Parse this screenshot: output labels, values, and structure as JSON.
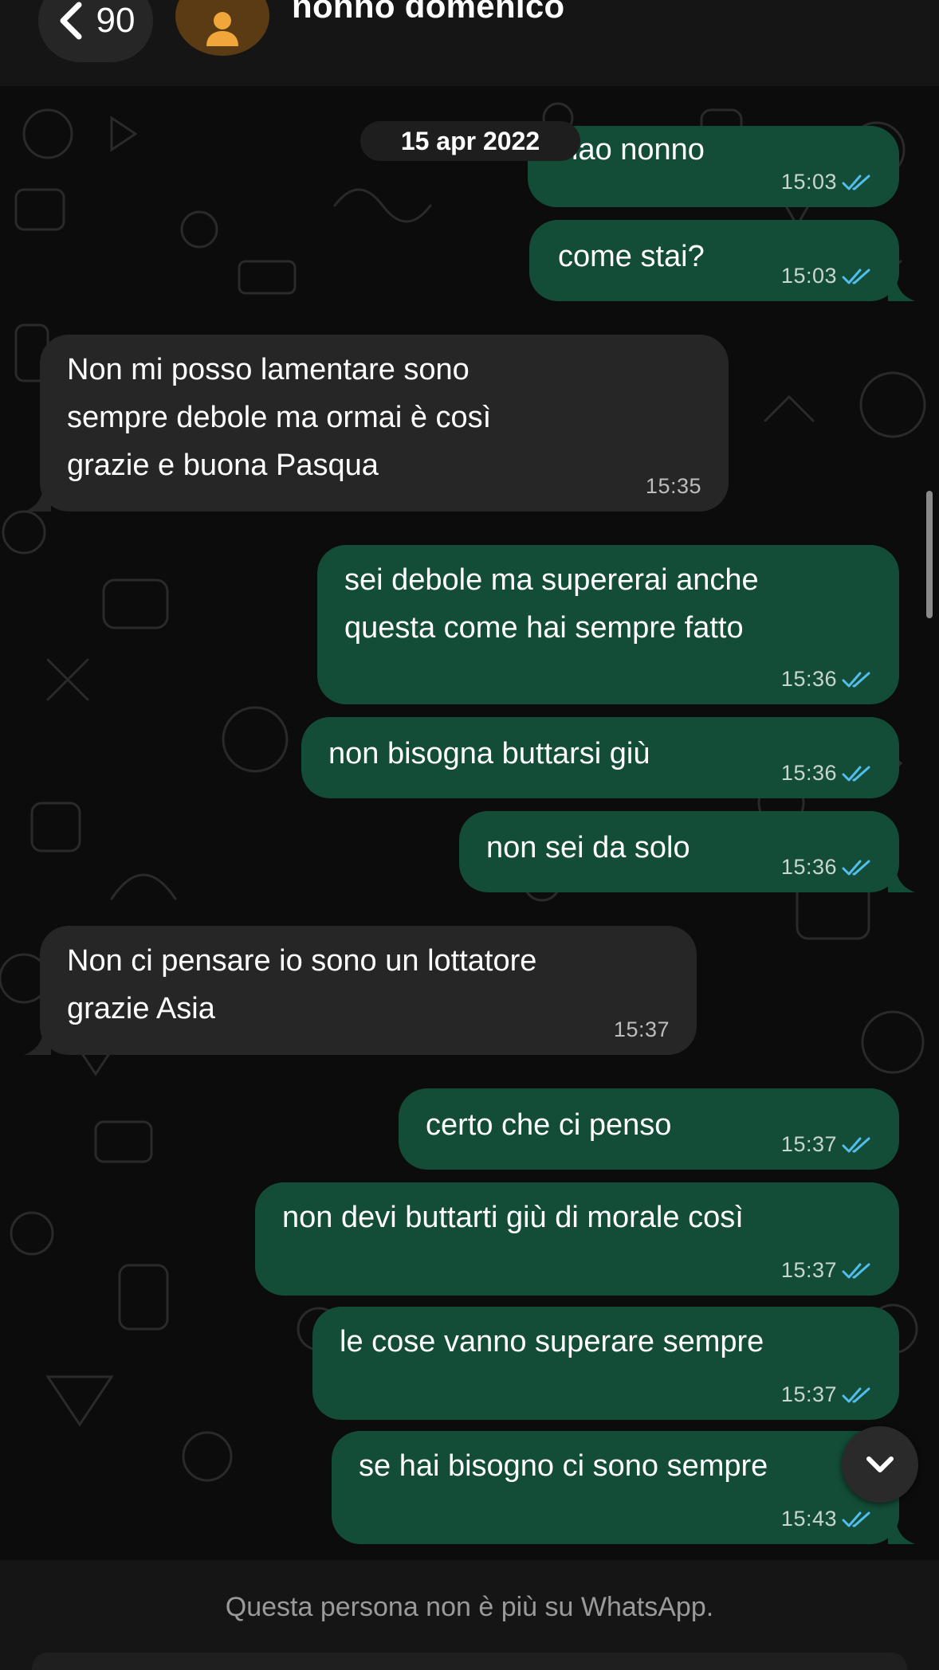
{
  "header": {
    "back_count": "90",
    "contact_name": "nonno domenico"
  },
  "chat": {
    "date_separator": "15 apr 2022",
    "messages": [
      {
        "direction": "outgoing",
        "text": "ciao nonno",
        "time": "15:03",
        "status": "read"
      },
      {
        "direction": "outgoing",
        "text": "come stai?",
        "time": "15:03",
        "status": "read"
      },
      {
        "direction": "incoming",
        "text": "Non mi posso lamentare sono\nsempre debole ma ormai è così\ngrazie e buona Pasqua",
        "time": "15:35"
      },
      {
        "direction": "outgoing",
        "text": "sei debole ma supererai anche\nquesta come hai sempre fatto",
        "time": "15:36",
        "status": "read"
      },
      {
        "direction": "outgoing",
        "text": "non bisogna buttarsi giù",
        "time": "15:36",
        "status": "read"
      },
      {
        "direction": "outgoing",
        "text": "non sei da solo",
        "time": "15:36",
        "status": "read"
      },
      {
        "direction": "incoming",
        "text": "Non ci pensare io sono un lottatore\ngrazie Asia",
        "time": "15:37"
      },
      {
        "direction": "outgoing",
        "text": "certo che ci penso",
        "time": "15:37",
        "status": "read"
      },
      {
        "direction": "outgoing",
        "text": "non devi buttarti giù di morale così",
        "time": "15:37",
        "status": "read"
      },
      {
        "direction": "outgoing",
        "text": "le cose vanno superare sempre",
        "time": "15:37",
        "status": "read"
      },
      {
        "direction": "outgoing",
        "text": "se hai bisogno ci sono sempre",
        "time": "15:43",
        "status": "read"
      }
    ]
  },
  "footer": {
    "notice": "Questa persona non è più su WhatsApp."
  },
  "colors": {
    "outgoing_bubble": "#134d37",
    "incoming_bubble": "#262626",
    "read_ticks": "#53bdeb",
    "background": "#0b0b0b"
  },
  "icons": {
    "back": "chevron-left-icon",
    "avatar": "person-icon",
    "read_receipt": "double-check-icon",
    "scroll_down": "chevron-down-icon"
  }
}
